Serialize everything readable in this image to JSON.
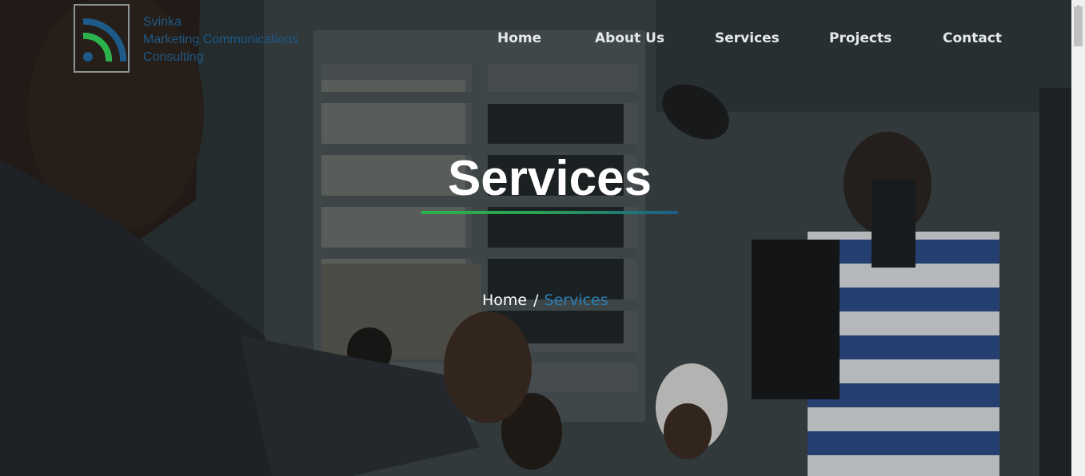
{
  "brand": {
    "name_line1": "Svinka",
    "name_line2": "Marketing Communications",
    "name_line3": "Consulting",
    "logo_icon": "signal-arc-icon",
    "colors": {
      "green": "#2bb24c",
      "blue": "#1d5a88"
    }
  },
  "nav": {
    "items": [
      {
        "label": "Home"
      },
      {
        "label": "About Us"
      },
      {
        "label": "Services"
      },
      {
        "label": "Projects"
      },
      {
        "label": "Contact"
      }
    ]
  },
  "hero": {
    "title": "Services",
    "background": "photo of a man in a suit gesturing at a camera crew and children"
  },
  "breadcrumb": {
    "home": "Home",
    "separator": "/",
    "current": "Services",
    "current_color": "#2b7fb4"
  }
}
